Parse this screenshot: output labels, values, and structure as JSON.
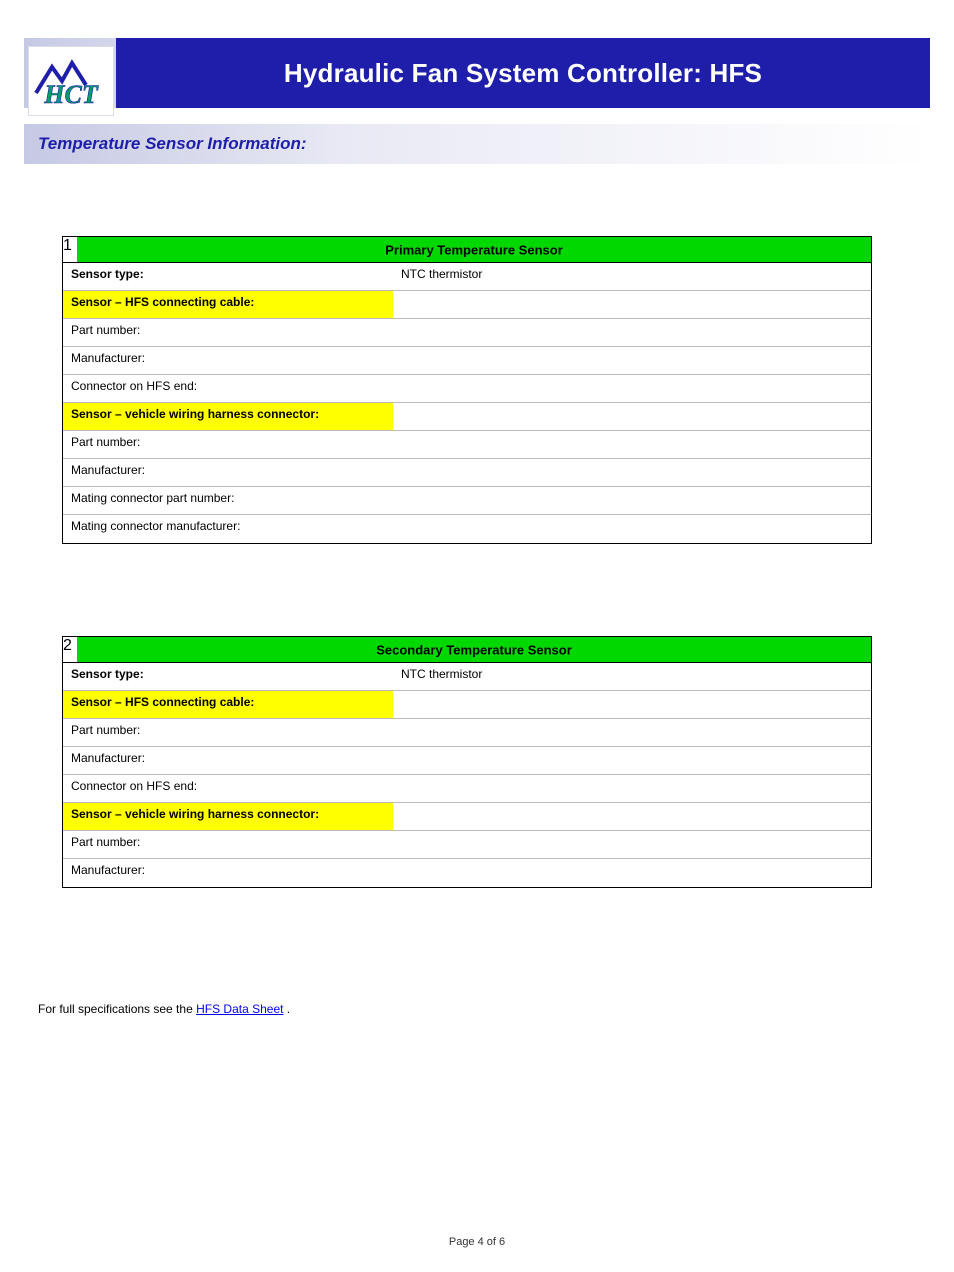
{
  "banner": {
    "title": "Hydraulic Fan System Controller: HFS"
  },
  "section": {
    "title": "Temperature Sensor Information:"
  },
  "box_a": {
    "header_num": "1",
    "header_text": "Primary Temperature Sensor",
    "first": {
      "label": "Sensor type:",
      "val": "NTC thermistor"
    },
    "sub_a": "Sensor – HFS connecting cable:",
    "rows_a": [
      {
        "label": "Part number:",
        "val": ""
      },
      {
        "label": "Manufacturer:",
        "val": ""
      },
      {
        "label": "Connector on HFS end:",
        "val": ""
      }
    ],
    "sub_b": "Sensor – vehicle wiring harness connector:",
    "rows_b": [
      {
        "label": "Part number:",
        "val": ""
      },
      {
        "label": "Manufacturer:",
        "val": ""
      },
      {
        "label": "Mating connector part number:",
        "val": ""
      },
      {
        "label": "Mating connector manufacturer:",
        "val": ""
      }
    ]
  },
  "box_b": {
    "header_num": "2",
    "header_text": "Secondary Temperature Sensor",
    "first": {
      "label": "Sensor type:",
      "val": "NTC thermistor"
    },
    "sub_a": "Sensor – HFS connecting cable:",
    "rows_a": [
      {
        "label": "Part number:",
        "val": ""
      },
      {
        "label": "Manufacturer:",
        "val": ""
      },
      {
        "label": "Connector on HFS end:",
        "val": ""
      }
    ],
    "sub_b": "Sensor – vehicle wiring harness connector:",
    "rows_b": [
      {
        "label": "Part number:",
        "val": ""
      },
      {
        "label": "Manufacturer:",
        "val": ""
      }
    ]
  },
  "note": {
    "pre": "For full specifications see the ",
    "link": "HFS Data Sheet",
    "post": "."
  },
  "footer": {
    "page": "Page 4 of 6"
  }
}
